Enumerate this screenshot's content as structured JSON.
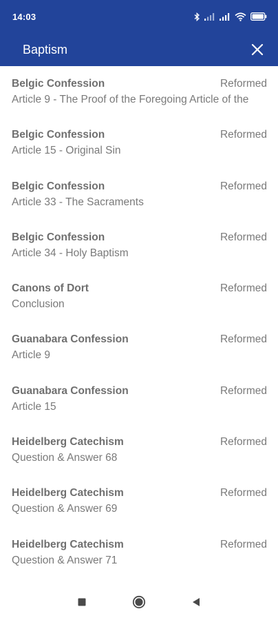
{
  "status_bar": {
    "time": "14:03",
    "icons": [
      "bluetooth-icon",
      "signal-icon",
      "signal-icon",
      "wifi-icon",
      "battery-icon"
    ]
  },
  "app_bar": {
    "title": "Baptism",
    "close_icon": "close-icon"
  },
  "items": [
    {
      "title": "Belgic Confession",
      "subtitle": "Article 9 - The Proof of the Foregoing Article of the",
      "tag": "Reformed"
    },
    {
      "title": "Belgic Confession",
      "subtitle": "Article 15 - Original Sin",
      "tag": "Reformed"
    },
    {
      "title": "Belgic Confession",
      "subtitle": "Article 33 - The Sacraments",
      "tag": "Reformed"
    },
    {
      "title": "Belgic Confession",
      "subtitle": "Article 34 - Holy Baptism",
      "tag": "Reformed"
    },
    {
      "title": "Canons of Dort",
      "subtitle": "Conclusion",
      "tag": "Reformed"
    },
    {
      "title": "Guanabara Confession",
      "subtitle": "Article 9",
      "tag": "Reformed"
    },
    {
      "title": "Guanabara Confession",
      "subtitle": "Article 15",
      "tag": "Reformed"
    },
    {
      "title": "Heidelberg Catechism",
      "subtitle": "Question & Answer 68",
      "tag": "Reformed"
    },
    {
      "title": "Heidelberg Catechism",
      "subtitle": "Question & Answer 69",
      "tag": "Reformed"
    },
    {
      "title": "Heidelberg Catechism",
      "subtitle": "Question & Answer 71",
      "tag": "Reformed"
    }
  ],
  "nav_bar": {
    "buttons": [
      "recents-icon",
      "home-icon",
      "back-icon"
    ]
  },
  "colors": {
    "header": "#22449a",
    "text": "#6b6b6b",
    "background": "#ffffff"
  }
}
